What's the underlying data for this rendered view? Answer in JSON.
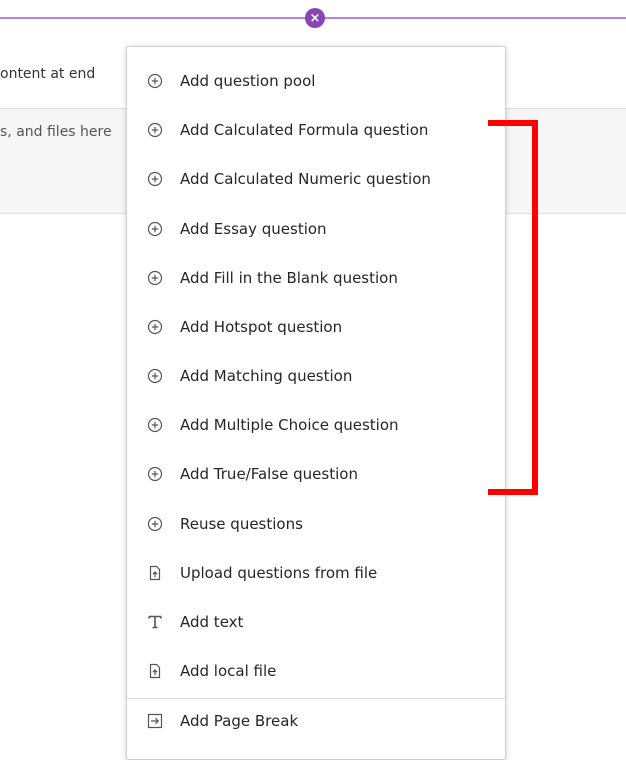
{
  "background": {
    "left_text_1": "ontent at end",
    "left_text_2": "s, and files here"
  },
  "colors": {
    "accent_purple": "#8a44b5",
    "line_purple": "#c27fe0",
    "highlight_red": "#ff0000"
  },
  "menu": {
    "items": [
      {
        "label": "Add question pool",
        "icon": "plus-circle-icon"
      },
      {
        "label": "Add Calculated Formula question",
        "icon": "plus-circle-icon"
      },
      {
        "label": "Add Calculated Numeric question",
        "icon": "plus-circle-icon"
      },
      {
        "label": "Add Essay question",
        "icon": "plus-circle-icon"
      },
      {
        "label": "Add Fill in the Blank question",
        "icon": "plus-circle-icon"
      },
      {
        "label": "Add Hotspot question",
        "icon": "plus-circle-icon"
      },
      {
        "label": "Add Matching question",
        "icon": "plus-circle-icon"
      },
      {
        "label": "Add Multiple Choice question",
        "icon": "plus-circle-icon"
      },
      {
        "label": "Add True/False question",
        "icon": "plus-circle-icon"
      },
      {
        "label": "Reuse questions",
        "icon": "plus-circle-icon"
      },
      {
        "label": "Upload questions from file",
        "icon": "file-upload-icon"
      },
      {
        "label": "Add text",
        "icon": "text-icon"
      },
      {
        "label": "Add local file",
        "icon": "file-upload-icon"
      },
      {
        "label": "Add Page Break",
        "icon": "page-break-icon"
      }
    ]
  }
}
